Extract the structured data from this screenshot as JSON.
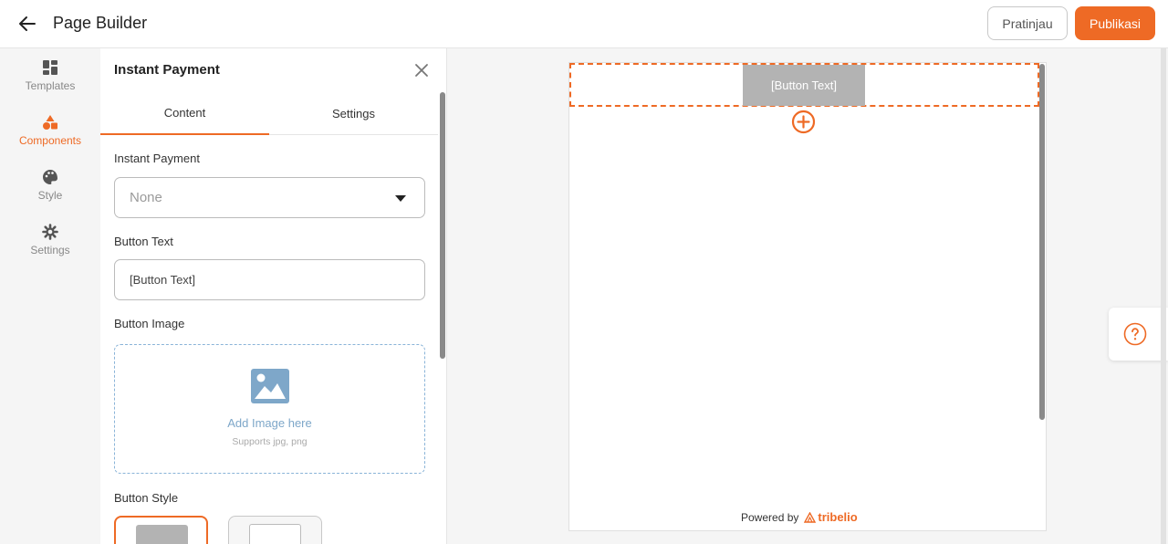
{
  "header": {
    "title": "Page Builder",
    "preview_label": "Pratinjau",
    "publish_label": "Publikasi"
  },
  "rail": {
    "items": [
      {
        "label": "Templates",
        "icon": "templates-icon"
      },
      {
        "label": "Components",
        "icon": "components-icon",
        "active": true
      },
      {
        "label": "Style",
        "icon": "palette-icon"
      },
      {
        "label": "Settings",
        "icon": "gear-icon"
      }
    ]
  },
  "panel": {
    "title": "Instant Payment",
    "tabs": [
      {
        "label": "Content",
        "active": true
      },
      {
        "label": "Settings"
      }
    ],
    "instant_payment": {
      "label": "Instant Payment",
      "value": "None"
    },
    "button_text": {
      "label": "Button Text",
      "value": "[Button Text]"
    },
    "button_image": {
      "label": "Button Image",
      "cta": "Add Image here",
      "hint": "Supports jpg, png"
    },
    "button_style": {
      "label": "Button Style"
    }
  },
  "canvas": {
    "button_label": "[Button Text]",
    "powered_by": "Powered by",
    "brand": "tribelio"
  },
  "colors": {
    "accent": "#ee6a25",
    "canvas_button": "#b3b3b3",
    "link_blue": "#7ea7c9"
  }
}
